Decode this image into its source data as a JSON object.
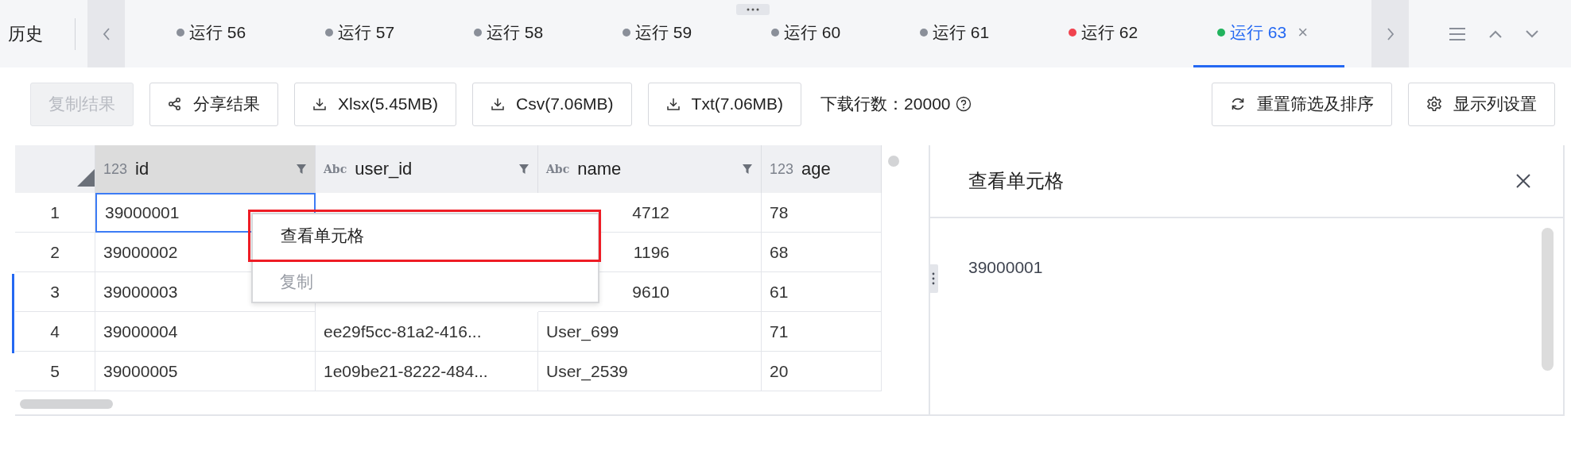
{
  "history_label": "历史",
  "tabs": [
    {
      "label": "运行 56",
      "color": "#8a8f99",
      "selected": false
    },
    {
      "label": "运行 57",
      "color": "#8a8f99",
      "selected": false
    },
    {
      "label": "运行 58",
      "color": "#8a8f99",
      "selected": false
    },
    {
      "label": "运行 59",
      "color": "#8a8f99",
      "selected": false
    },
    {
      "label": "运行 60",
      "color": "#8a8f99",
      "selected": false
    },
    {
      "label": "运行 61",
      "color": "#8a8f99",
      "selected": false
    },
    {
      "label": "运行 62",
      "color": "#f0434f",
      "selected": false
    },
    {
      "label": "运行 63",
      "color": "#22b35e",
      "selected": true,
      "close": "×"
    }
  ],
  "toolbar": {
    "buttons": [
      {
        "label": "复制结果",
        "kind": "plain",
        "disabled": true
      },
      {
        "label": "分享结果",
        "kind": "share",
        "disabled": false
      },
      {
        "label": "Xlsx(5.45MB)",
        "kind": "download",
        "disabled": false
      },
      {
        "label": "Csv(7.06MB)",
        "kind": "download",
        "disabled": false
      },
      {
        "label": "Txt(7.06MB)",
        "kind": "download",
        "disabled": false
      }
    ],
    "row_count_label": "下载行数：20000",
    "right_buttons": [
      {
        "label": "重置筛选及排序",
        "kind": "refresh",
        "disabled": false
      },
      {
        "label": "显示列设置",
        "kind": "settings",
        "disabled": false
      }
    ]
  },
  "table": {
    "columns": [
      {
        "type": "123",
        "name": "id",
        "filter": true,
        "selected": true
      },
      {
        "type": "Abc",
        "name": "user_id",
        "filter": true,
        "selected": false
      },
      {
        "type": "Abc",
        "name": "name",
        "filter": true,
        "selected": false
      },
      {
        "type": "123",
        "name": "age",
        "filter": false,
        "selected": false
      }
    ],
    "rows": [
      {
        "num": "1",
        "cells": [
          "39000001",
          "",
          "4712",
          "78"
        ],
        "covered": true
      },
      {
        "num": "2",
        "cells": [
          "39000002",
          "",
          "1196",
          "68"
        ],
        "covered": true
      },
      {
        "num": "3",
        "cells": [
          "39000003",
          "",
          "9610",
          "61"
        ],
        "covered": true
      },
      {
        "num": "4",
        "cells": [
          "39000004",
          "ee29f5cc-81a2-416...",
          "User_699",
          "71"
        ],
        "covered": false
      },
      {
        "num": "5",
        "cells": [
          "39000005",
          "1e09be21-8222-484...",
          "User_2539",
          "20"
        ],
        "covered": false
      }
    ]
  },
  "context_menu": [
    {
      "label": "查看单元格",
      "disabled": false,
      "selected": true
    },
    {
      "label": "复制",
      "disabled": true,
      "selected": false
    }
  ],
  "cell_panel": {
    "title": "查看单元格",
    "value": "39000001"
  }
}
